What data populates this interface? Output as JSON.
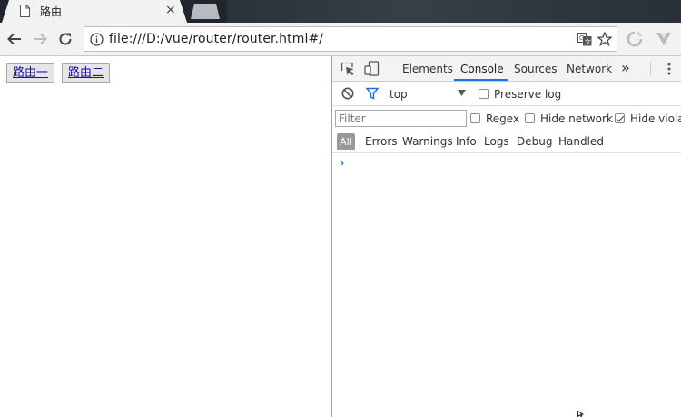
{
  "browser": {
    "tab_title": "路由",
    "tab_close": "×",
    "url": "file:///D:/vue/router/router.html#/"
  },
  "page": {
    "links": [
      {
        "label": "路由一"
      },
      {
        "label": "路由二"
      }
    ]
  },
  "devtools": {
    "tabs": [
      "Elements",
      "Console",
      "Sources",
      "Network"
    ],
    "active_tab": "Console",
    "more_tabs": "»",
    "context": "top",
    "preserve_log": "Preserve log",
    "filter_placeholder": "Filter",
    "options": {
      "regex": "Regex",
      "hide_network": "Hide network",
      "hide_violations": "Hide violat"
    },
    "levels": [
      "All",
      "Errors",
      "Warnings",
      "Info",
      "Logs",
      "Debug",
      "Handled"
    ],
    "prompt": "›"
  },
  "colors": {
    "accent": "#1a73e8",
    "link": "#1a0dab"
  }
}
